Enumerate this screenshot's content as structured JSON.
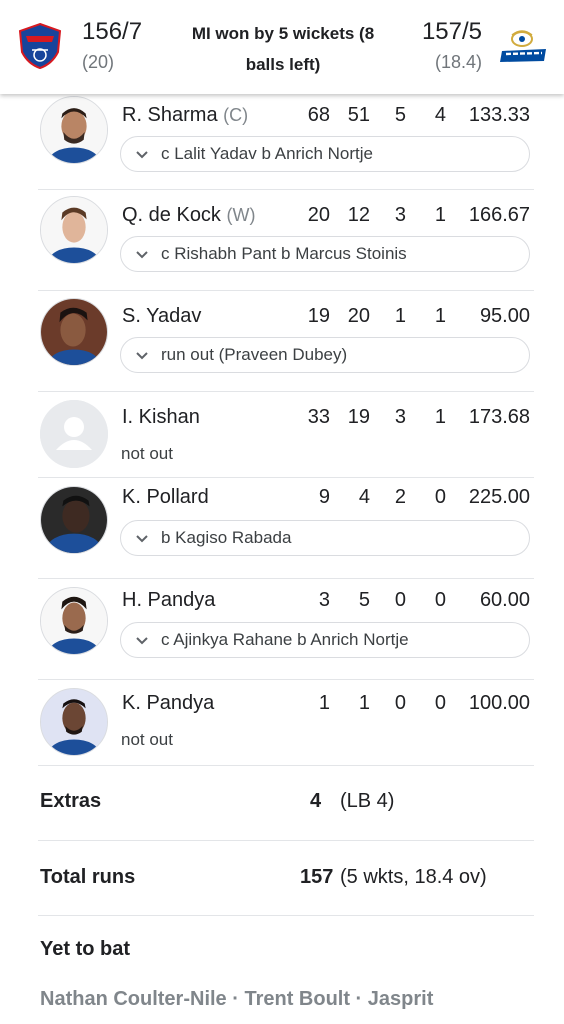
{
  "header": {
    "team1": {
      "name_logo": "DELHI CAPITALS",
      "score": "156/7",
      "overs": "(20)"
    },
    "team2": {
      "name_logo": "MUMBAI INDIANS",
      "score": "157/5",
      "overs": "(18.4)"
    },
    "result_line1": "MI won by 5 wickets (8",
    "result_line2": "balls left)"
  },
  "batting": [
    {
      "name": "R. Sharma",
      "role": "(C)",
      "runs": "68",
      "balls": "51",
      "fours": "5",
      "sixes": "4",
      "sr": "133.33",
      "dismissal": "c Lalit Yadav b Anrich Nortje",
      "not_out": ""
    },
    {
      "name": "Q. de Kock",
      "role": "(W)",
      "runs": "20",
      "balls": "12",
      "fours": "3",
      "sixes": "1",
      "sr": "166.67",
      "dismissal": "c Rishabh Pant b Marcus Stoinis",
      "not_out": ""
    },
    {
      "name": "S. Yadav",
      "role": "",
      "runs": "19",
      "balls": "20",
      "fours": "1",
      "sixes": "1",
      "sr": "95.00",
      "dismissal": "run out (Praveen Dubey)",
      "not_out": ""
    },
    {
      "name": "I. Kishan",
      "role": "",
      "runs": "33",
      "balls": "19",
      "fours": "3",
      "sixes": "1",
      "sr": "173.68",
      "dismissal": "",
      "not_out": "not out"
    },
    {
      "name": "K. Pollard",
      "role": "",
      "runs": "9",
      "balls": "4",
      "fours": "2",
      "sixes": "0",
      "sr": "225.00",
      "dismissal": "b Kagiso Rabada",
      "not_out": ""
    },
    {
      "name": "H. Pandya",
      "role": "",
      "runs": "3",
      "balls": "5",
      "fours": "0",
      "sixes": "0",
      "sr": "60.00",
      "dismissal": "c Ajinkya Rahane b Anrich Nortje",
      "not_out": ""
    },
    {
      "name": "K. Pandya",
      "role": "",
      "runs": "1",
      "balls": "1",
      "fours": "0",
      "sixes": "0",
      "sr": "100.00",
      "dismissal": "",
      "not_out": "not out"
    }
  ],
  "extras": {
    "label": "Extras",
    "value": "4",
    "detail": "(LB 4)"
  },
  "total": {
    "label": "Total runs",
    "value": "157",
    "detail": "(5 wkts, 18.4 ov)"
  },
  "yet_to_bat": {
    "label": "Yet to bat",
    "players": "Nathan Coulter-Nile · Trent Boult · Jasprit"
  },
  "colors": {
    "mi_blue": "#004ba0",
    "dc_blue": "#17449b",
    "dc_red": "#d71920",
    "gold": "#d1ab3e"
  }
}
